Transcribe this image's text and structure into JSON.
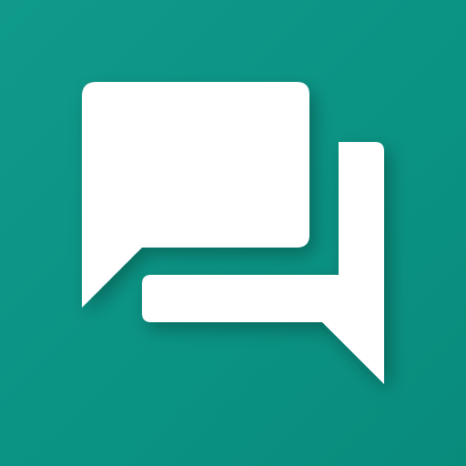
{
  "app_icon": {
    "icon": "chat-bubbles-icon",
    "colors": {
      "background": "#0a9282",
      "bubble": "#ffffff",
      "shadow": "#00564b"
    },
    "bubbles": [
      {
        "icon": "chat-bubble-front-icon"
      },
      {
        "icon": "chat-bubble-back-icon"
      }
    ]
  }
}
